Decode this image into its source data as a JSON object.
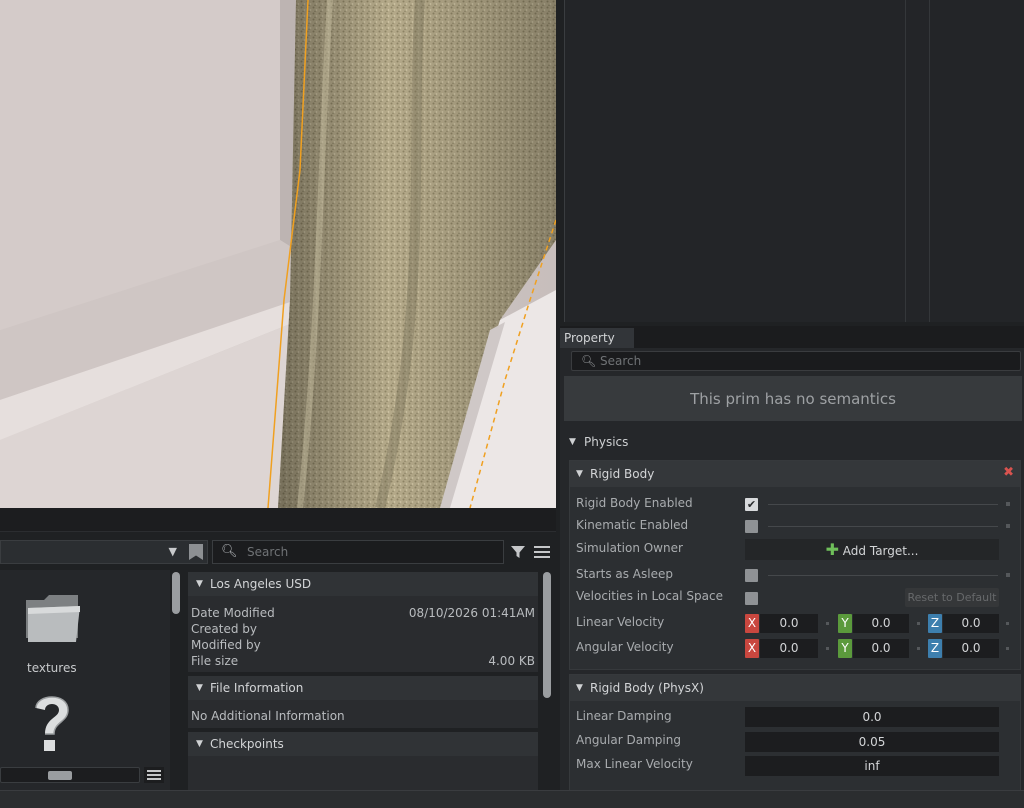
{
  "property_panel": {
    "tab_label": "Property",
    "search_placeholder": "Search",
    "semantics_message": "This prim has no semantics",
    "physics_section": "Physics",
    "rigid_body": {
      "title": "Rigid Body",
      "rows": {
        "enabled_label": "Rigid Body Enabled",
        "kinematic_label": "Kinematic Enabled",
        "sim_owner_label": "Simulation Owner",
        "add_target_label": "Add Target...",
        "asleep_label": "Starts as Asleep",
        "local_space_label": "Velocities in Local Space",
        "reset_label": "Reset to Default",
        "linear_velocity_label": "Linear Velocity",
        "angular_velocity_label": "Angular Velocity"
      },
      "enabled": true,
      "kinematic": false,
      "asleep": false,
      "local_space": false,
      "axis_labels": {
        "x": "X",
        "y": "Y",
        "z": "Z"
      },
      "linear_velocity": {
        "x": "0.0",
        "y": "0.0",
        "z": "0.0"
      },
      "angular_velocity": {
        "x": "0.0",
        "y": "0.0",
        "z": "0.0"
      }
    },
    "physx": {
      "title": "Rigid Body (PhysX)",
      "linear_damping_label": "Linear Damping",
      "linear_damping": "0.0",
      "angular_damping_label": "Angular Damping",
      "angular_damping": "0.05",
      "max_linear_velocity_label": "Max Linear Velocity",
      "max_linear_velocity": "inf"
    }
  },
  "content_browser": {
    "search_placeholder": "Search",
    "files": [
      {
        "name": "textures",
        "icon": "folder-icon"
      },
      {
        "name": "",
        "icon": "question-mark-icon"
      }
    ],
    "details": {
      "file_name": "Los Angeles USD",
      "date_modified_label": "Date Modified",
      "date_modified": "08/10/2026 01:41AM",
      "created_by_label": "Created by",
      "modified_by_label": "Modified by",
      "file_size_label": "File size",
      "file_size": "4.00 KB",
      "file_info_title": "File Information",
      "no_info": "No Additional Information",
      "checkpoints_title": "Checkpoints"
    }
  },
  "colors": {
    "axis_x": "#c9473f",
    "axis_y": "#5b9a3c",
    "axis_z": "#3d7fae",
    "selection_outline": "#f0a020"
  }
}
